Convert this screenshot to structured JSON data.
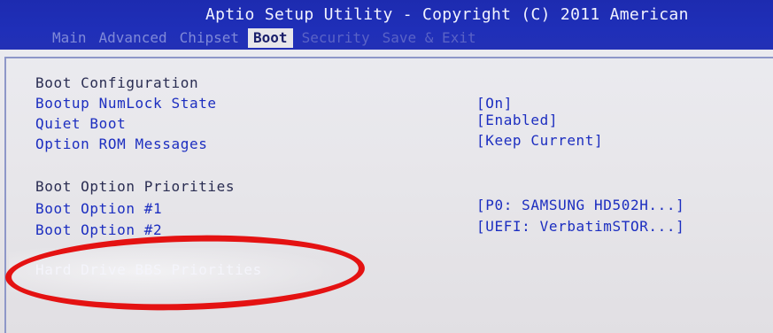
{
  "header": {
    "title": "Aptio Setup Utility - Copyright (C) 2011 American",
    "tabs": [
      {
        "label": "Main"
      },
      {
        "label": "Advanced"
      },
      {
        "label": "Chipset"
      },
      {
        "label": "Boot"
      },
      {
        "label": "Security"
      },
      {
        "label": "Save & Exit"
      }
    ],
    "active_tab": "Boot"
  },
  "content": {
    "boot_configuration": {
      "section_label": "Boot Configuration",
      "items": [
        {
          "label": "Bootup NumLock State",
          "value": "[On]"
        },
        {
          "label": "Quiet Boot",
          "value": "[Enabled]"
        },
        {
          "label": "Option ROM Messages",
          "value": "[Keep Current]"
        }
      ]
    },
    "boot_option_priorities": {
      "section_label": "Boot Option Priorities",
      "items": [
        {
          "label": "Boot Option #1",
          "value": "[P0: SAMSUNG HD502H...]"
        },
        {
          "label": "Boot Option #2",
          "value": "[UEFI: VerbatimSTOR...]"
        }
      ]
    },
    "selected_item": {
      "label": "Hard Drive BBS Priorities"
    }
  },
  "colors": {
    "header_bg": "#1f2fb8",
    "item_text": "#1c2ec0",
    "section_text": "#2a2d52",
    "highlight_circle": "#e41212"
  }
}
